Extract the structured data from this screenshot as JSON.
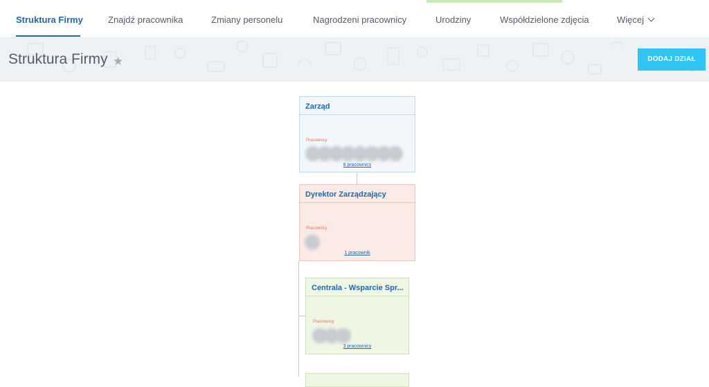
{
  "tabs": [
    {
      "label": "Struktura Firmy"
    },
    {
      "label": "Znajdź pracownika"
    },
    {
      "label": "Zmiany personelu"
    },
    {
      "label": "Nagrodzeni pracownicy"
    },
    {
      "label": "Urodziny"
    },
    {
      "label": "Współdzielone zdjęcia"
    },
    {
      "label": "Więcej"
    }
  ],
  "active_tab": "Struktura Firmy",
  "header": {
    "title": "Struktura Firmy",
    "add_button": "DODAJ DZIAŁ"
  },
  "departments": [
    {
      "name": "Zarząd",
      "employees_label": "Pracownicy",
      "count_label": "8 pracownicy",
      "avatar_count": 8
    },
    {
      "name": "Dyrektor Zarządzający",
      "employees_label": "Pracownicy",
      "count_label": "1 pracownik",
      "avatar_count": 1
    },
    {
      "name": "Centrala - Wsparcie Spr...",
      "employees_label": "Pracownicy",
      "count_label": "3 pracownicy",
      "avatar_count": 3
    }
  ],
  "colors": {
    "accent": "#2067b0",
    "button": "#2fc6f6",
    "level1_bg": "#f1f7fb",
    "level2_bg": "#fbebe6",
    "level3_bg": "#eff6e4"
  }
}
